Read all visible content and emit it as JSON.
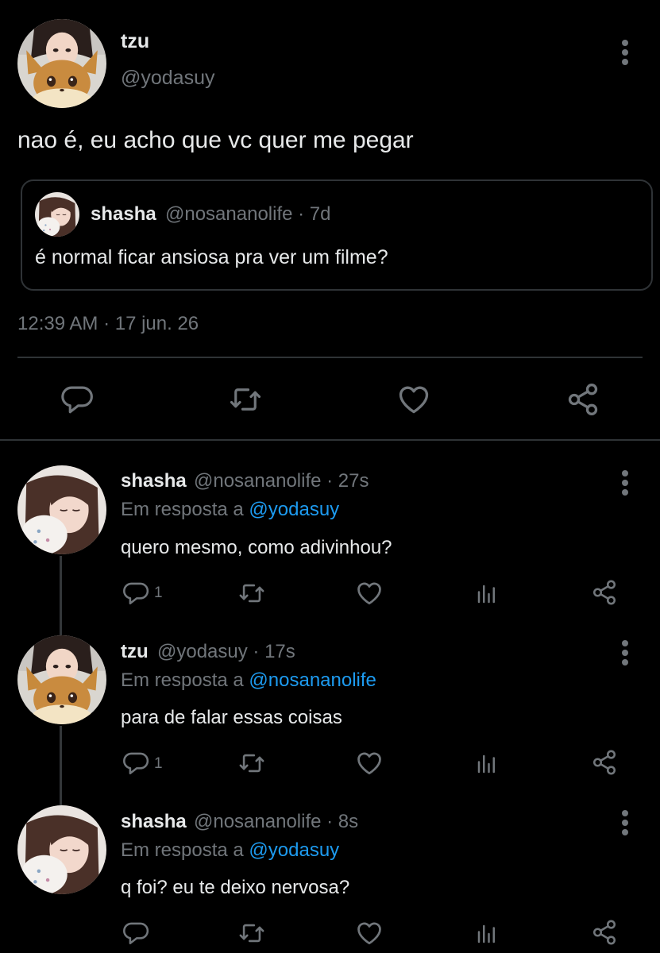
{
  "main_tweet": {
    "name": "tzu",
    "handle": "@yodasuy",
    "text": "nao é, eu acho que vc quer me pegar",
    "quote": {
      "name": "shasha",
      "meta": "@nosananolife · 7d",
      "text": "é normal ficar ansiosa pra ver um filme?"
    },
    "timestamp": "12:39 AM · 17 jun. 26",
    "actions": [
      "reply-icon",
      "retweet-icon",
      "like-icon",
      "share-icon"
    ]
  },
  "replies": [
    {
      "name": "shasha",
      "meta": "@nosananolife · 27s",
      "reply_prefix": "Em resposta a",
      "reply_to": "@yodasuy",
      "text": "quero mesmo, como adivinhou?",
      "reply_count": "1"
    },
    {
      "name": "tzu",
      "meta": "@yodasuy · 17s",
      "reply_prefix": "Em resposta a",
      "reply_to": "@nosananolife",
      "text": "para de falar essas coisas",
      "reply_count": "1"
    },
    {
      "name": "shasha",
      "meta": "@nosananolife · 8s",
      "reply_prefix": "Em resposta a",
      "reply_to": "@yodasuy",
      "text": "q foi? eu te deixo nervosa?",
      "reply_count": ""
    }
  ],
  "colors": {
    "background": "#000000",
    "text": "#e7e9ea",
    "muted": "#71767b",
    "link": "#1d9bf0",
    "border": "#2f3336"
  }
}
